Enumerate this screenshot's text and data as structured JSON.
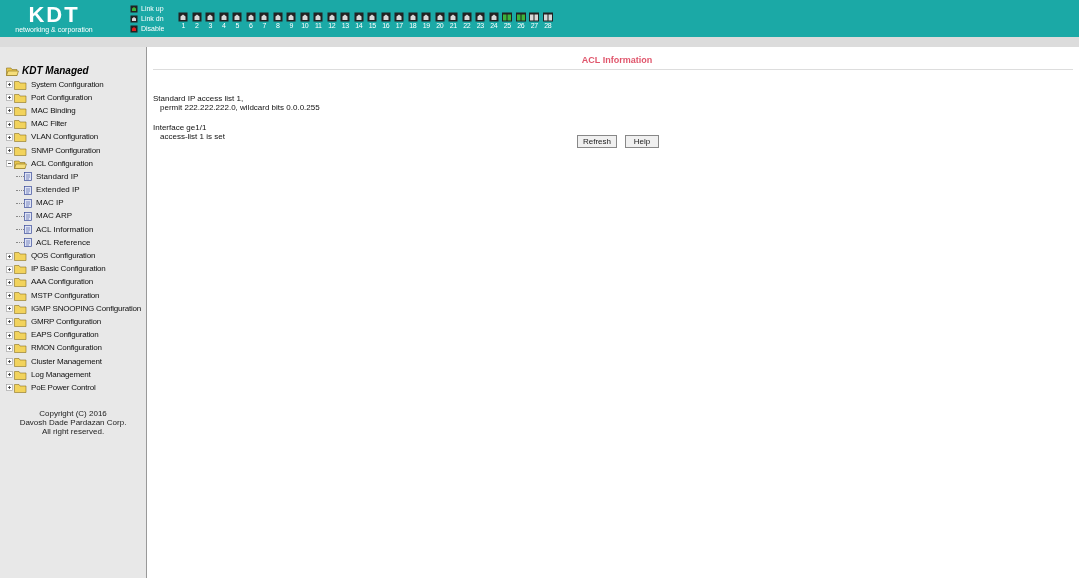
{
  "header": {
    "logo": {
      "text": "KDT",
      "tagline": "networking & corporation"
    },
    "legend": [
      {
        "label": "Link up",
        "kind": "up"
      },
      {
        "label": "Link dn",
        "kind": "down"
      },
      {
        "label": "Disable",
        "kind": "disabled"
      }
    ],
    "ports": [
      {
        "number": "1",
        "link_up": false,
        "kind": "rj45"
      },
      {
        "number": "2",
        "link_up": false,
        "kind": "rj45"
      },
      {
        "number": "3",
        "link_up": false,
        "kind": "rj45"
      },
      {
        "number": "4",
        "link_up": false,
        "kind": "rj45"
      },
      {
        "number": "5",
        "link_up": false,
        "kind": "rj45"
      },
      {
        "number": "6",
        "link_up": false,
        "kind": "rj45"
      },
      {
        "number": "7",
        "link_up": false,
        "kind": "rj45"
      },
      {
        "number": "8",
        "link_up": false,
        "kind": "rj45"
      },
      {
        "number": "9",
        "link_up": false,
        "kind": "rj45"
      },
      {
        "number": "10",
        "link_up": false,
        "kind": "rj45"
      },
      {
        "number": "11",
        "link_up": false,
        "kind": "rj45"
      },
      {
        "number": "12",
        "link_up": false,
        "kind": "rj45"
      },
      {
        "number": "13",
        "link_up": false,
        "kind": "rj45"
      },
      {
        "number": "14",
        "link_up": false,
        "kind": "rj45"
      },
      {
        "number": "15",
        "link_up": false,
        "kind": "rj45"
      },
      {
        "number": "16",
        "link_up": false,
        "kind": "rj45"
      },
      {
        "number": "17",
        "link_up": false,
        "kind": "rj45"
      },
      {
        "number": "18",
        "link_up": false,
        "kind": "rj45"
      },
      {
        "number": "19",
        "link_up": false,
        "kind": "rj45"
      },
      {
        "number": "20",
        "link_up": false,
        "kind": "rj45"
      },
      {
        "number": "21",
        "link_up": false,
        "kind": "rj45"
      },
      {
        "number": "22",
        "link_up": false,
        "kind": "rj45"
      },
      {
        "number": "23",
        "link_up": false,
        "kind": "rj45"
      },
      {
        "number": "24",
        "link_up": false,
        "kind": "rj45"
      },
      {
        "number": "25",
        "link_up": true,
        "kind": "combo"
      },
      {
        "number": "26",
        "link_up": true,
        "kind": "combo"
      },
      {
        "number": "27",
        "link_up": false,
        "kind": "combo"
      },
      {
        "number": "28",
        "link_up": false,
        "kind": "combo"
      }
    ]
  },
  "sidebar": {
    "root": "KDT Managed",
    "items": [
      {
        "label": "System Configuration",
        "kind": "folder",
        "expanded": false
      },
      {
        "label": "Port Configuration",
        "kind": "folder",
        "expanded": false
      },
      {
        "label": "MAC Binding",
        "kind": "folder",
        "expanded": false
      },
      {
        "label": "MAC Filter",
        "kind": "folder",
        "expanded": false
      },
      {
        "label": "VLAN Configuration",
        "kind": "folder",
        "expanded": false
      },
      {
        "label": "SNMP Configuration",
        "kind": "folder",
        "expanded": false
      },
      {
        "label": "ACL Configuration",
        "kind": "folder",
        "expanded": true,
        "children": [
          {
            "label": "Standard IP",
            "kind": "page"
          },
          {
            "label": "Extended IP",
            "kind": "page"
          },
          {
            "label": "MAC IP",
            "kind": "page"
          },
          {
            "label": "MAC ARP",
            "kind": "page"
          },
          {
            "label": "ACL Information",
            "kind": "page"
          },
          {
            "label": "ACL Reference",
            "kind": "page"
          }
        ]
      },
      {
        "label": "QOS Configuration",
        "kind": "folder",
        "expanded": false
      },
      {
        "label": "IP Basic Configuration",
        "kind": "folder",
        "expanded": false
      },
      {
        "label": "AAA Configuration",
        "kind": "folder",
        "expanded": false
      },
      {
        "label": "MSTP Configuration",
        "kind": "folder",
        "expanded": false
      },
      {
        "label": "IGMP SNOOPING Configuration",
        "kind": "folder",
        "expanded": false
      },
      {
        "label": "GMRP Configuration",
        "kind": "folder",
        "expanded": false
      },
      {
        "label": "EAPS Configuration",
        "kind": "folder",
        "expanded": false
      },
      {
        "label": "RMON Configuration",
        "kind": "folder",
        "expanded": false
      },
      {
        "label": "Cluster Management",
        "kind": "folder",
        "expanded": false
      },
      {
        "label": "Log Management",
        "kind": "folder",
        "expanded": false
      },
      {
        "label": "PoE Power Control",
        "kind": "folder",
        "expanded": false
      }
    ],
    "copyright": [
      "Copyright (C) 2016",
      "Davosh Dade Pardazan Corp.",
      "All right reserved."
    ]
  },
  "content": {
    "title": "ACL Information",
    "blocks": [
      [
        "Standard IP access list 1,",
        "permit 222.222.222.0, wildcard bits 0.0.0.255"
      ],
      [
        "Interface ge1/1",
        "access-list 1 is set"
      ]
    ],
    "buttons": [
      "Refresh",
      "Help"
    ]
  }
}
